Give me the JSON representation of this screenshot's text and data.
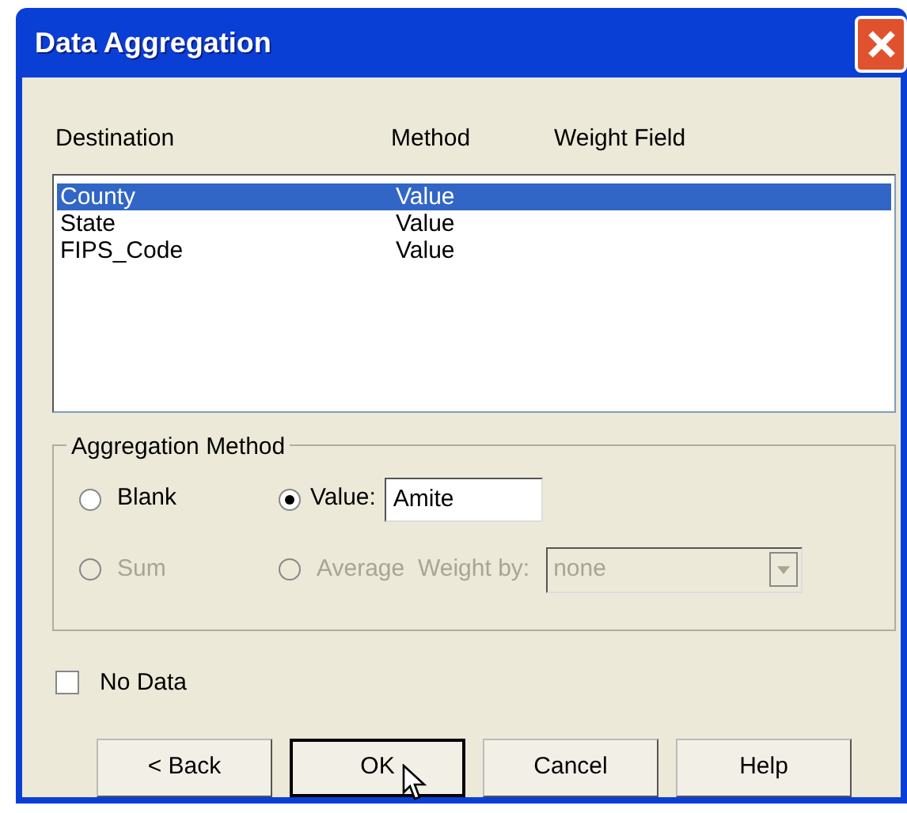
{
  "window": {
    "title": "Data Aggregation"
  },
  "columns": [
    "Destination",
    "Method",
    "Weight Field"
  ],
  "rows": [
    {
      "destination": "County",
      "method": "Value",
      "selected": true
    },
    {
      "destination": "State",
      "method": "Value",
      "selected": false
    },
    {
      "destination": "FIPS_Code",
      "method": "Value",
      "selected": false
    }
  ],
  "aggregation_method": {
    "title": "Aggregation Method",
    "options": [
      {
        "label": "Blank",
        "selected": false,
        "disabled": false
      },
      {
        "label": "Value:",
        "selected": true,
        "disabled": false
      },
      {
        "label": "Sum",
        "selected": false,
        "disabled": true
      },
      {
        "label": "Average",
        "selected": false,
        "disabled": true
      }
    ],
    "value_field": {
      "value": "Amite"
    },
    "weight_by": {
      "label": "Weight by:",
      "value": "none",
      "disabled": true
    }
  },
  "no_data": {
    "label": "No Data",
    "checked": false
  },
  "buttons": [
    {
      "label": "< Back",
      "default": false
    },
    {
      "label": "OK",
      "default": true
    },
    {
      "label": "Cancel",
      "default": false
    },
    {
      "label": "Help",
      "default": false
    }
  ]
}
